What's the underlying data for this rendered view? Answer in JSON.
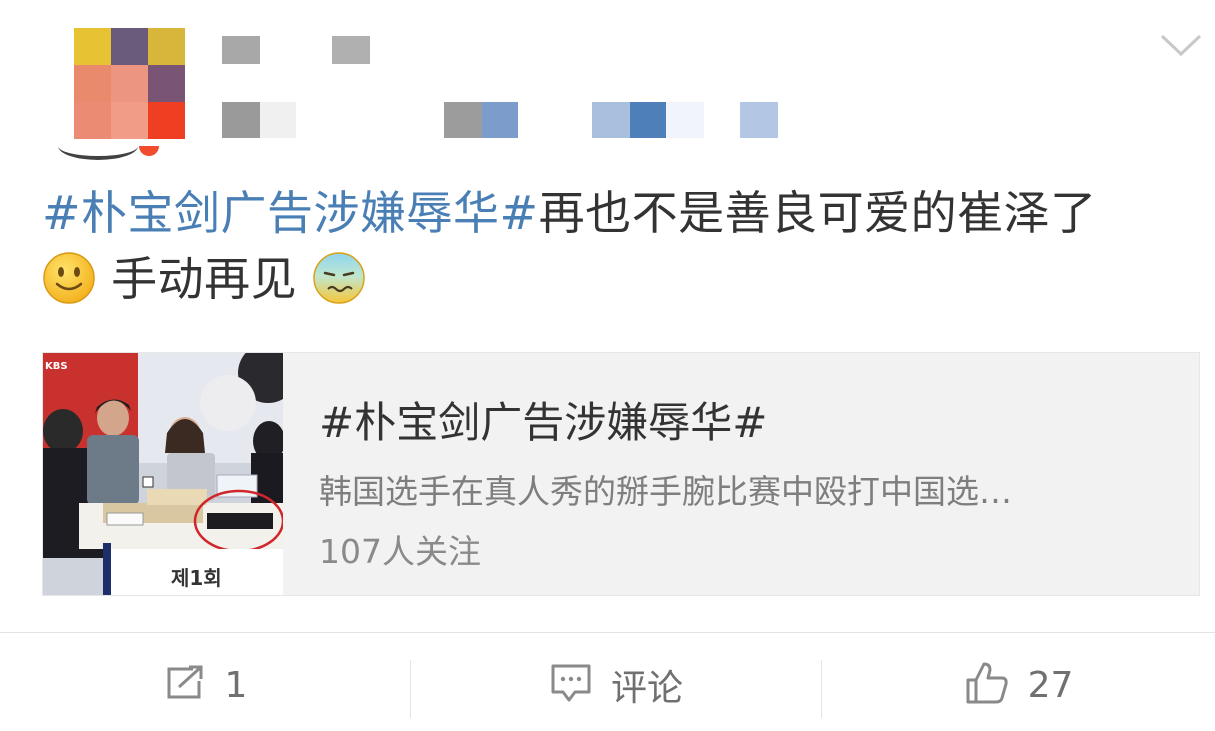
{
  "post": {
    "hashtag": "#朴宝剑广告涉嫌辱华#",
    "text_line1": "再也不是善良可爱的崔泽了",
    "text_line2": "手动再见",
    "emoji1": "smile-emoji",
    "emoji2": "cold-sweat-emoji"
  },
  "header": {
    "menu_icon": "chevron-down-icon"
  },
  "card": {
    "title": "#朴宝剑广告涉嫌辱华#",
    "description": "韩国选手在真人秀的掰手腕比赛中殴打中国选…",
    "followers": "107人关注",
    "thumb_label": "제1회"
  },
  "actions": {
    "repost_count": "1",
    "comment_label": "评论",
    "like_count": "27"
  },
  "colors": {
    "hashtag": "#4a7fb5",
    "card_bg": "#f2f2f2",
    "muted": "#7e7e7e"
  }
}
